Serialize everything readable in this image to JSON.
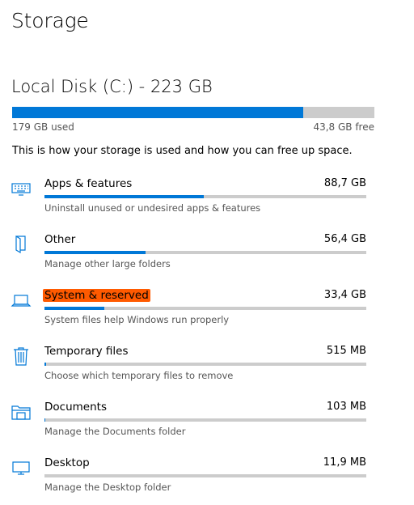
{
  "page": {
    "title": "Storage"
  },
  "disk": {
    "title": "Local Disk (C:) - 223 GB",
    "used_label": "179 GB used",
    "free_label": "43,8 GB free",
    "used_fraction": 0.804
  },
  "intro": "This is how your storage is used and how you can free up space.",
  "accent_color": "#0078d7",
  "highlight_color": "#ff5a00",
  "categories": [
    {
      "name": "Apps & features",
      "size": "88,7 GB",
      "description": "Uninstall unused or undesired apps & features",
      "icon": "keyboard-icon",
      "fraction": 0.494,
      "highlighted": false
    },
    {
      "name": "Other",
      "size": "56,4 GB",
      "description": "Manage other large folders",
      "icon": "document-icon",
      "fraction": 0.314,
      "highlighted": false
    },
    {
      "name": "System & reserved",
      "size": "33,4 GB",
      "description": "System files help Windows run properly",
      "icon": "laptop-icon",
      "fraction": 0.186,
      "highlighted": true
    },
    {
      "name": "Temporary files",
      "size": "515 MB",
      "description": "Choose which temporary files to remove",
      "icon": "trash-icon",
      "fraction": 0.004,
      "highlighted": false
    },
    {
      "name": "Documents",
      "size": "103 MB",
      "description": "Manage the Documents folder",
      "icon": "folder-icon",
      "fraction": 0.001,
      "highlighted": false
    },
    {
      "name": "Desktop",
      "size": "11,9 MB",
      "description": "Manage the Desktop folder",
      "icon": "monitor-icon",
      "fraction": 0.0,
      "highlighted": false
    }
  ]
}
